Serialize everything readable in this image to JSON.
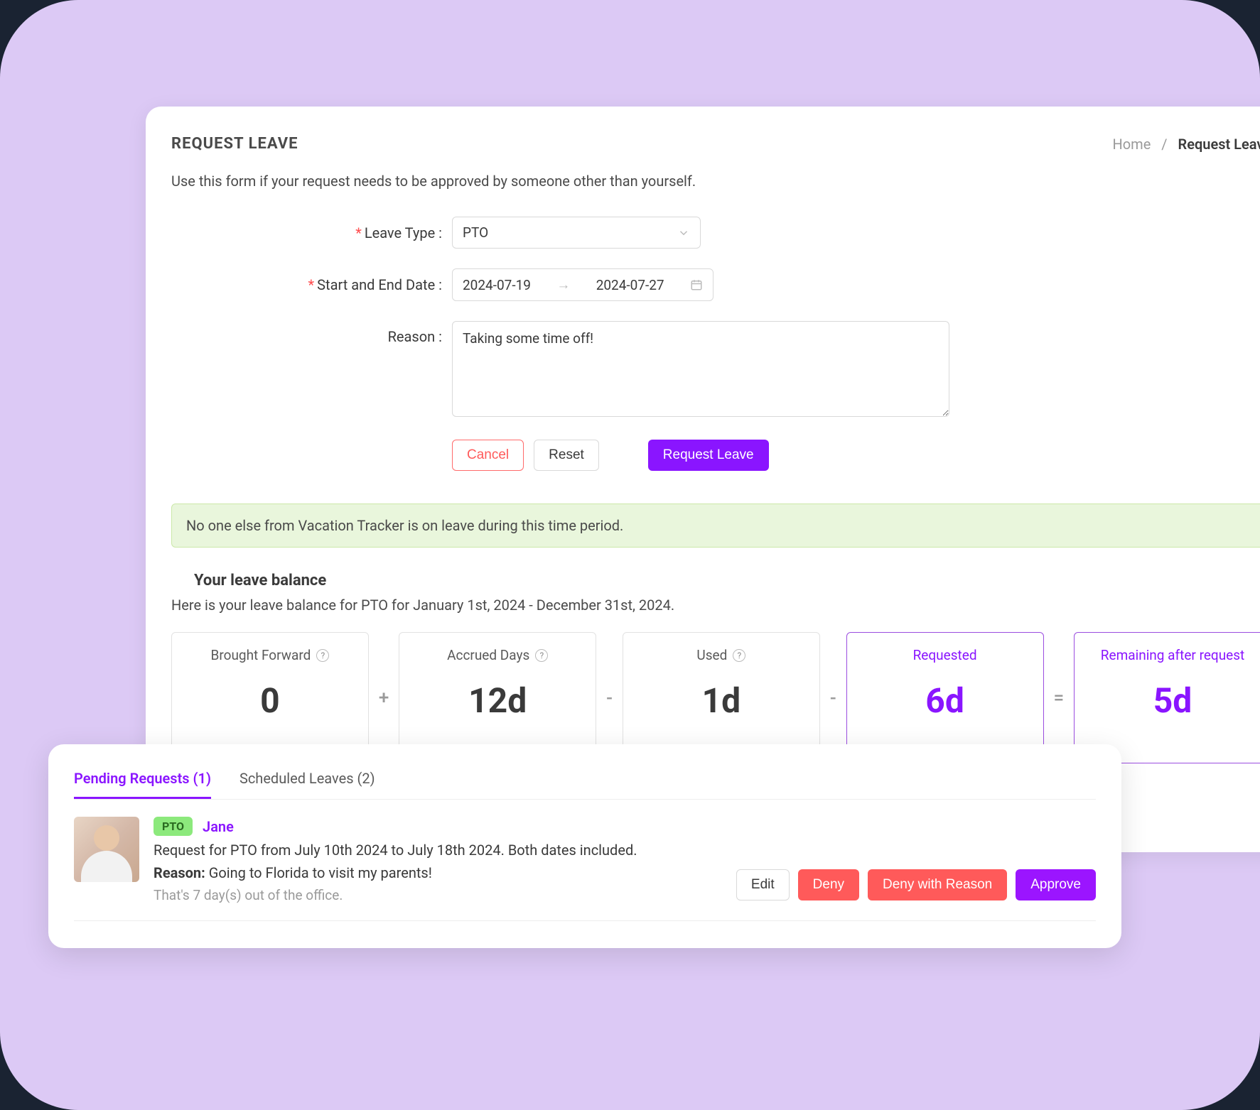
{
  "header": {
    "title": "REQUEST LEAVE",
    "breadcrumb": {
      "home": "Home",
      "current": "Request Leave"
    },
    "subtitle": "Use this form if your request needs to be approved by someone other than yourself."
  },
  "form": {
    "leave_type_label": "Leave Type :",
    "leave_type_value": "PTO",
    "date_label": "Start and End Date :",
    "start_date": "2024-07-19",
    "end_date": "2024-07-27",
    "reason_label": "Reason :",
    "reason_value": "Taking some time off!",
    "buttons": {
      "cancel": "Cancel",
      "reset": "Reset",
      "submit": "Request Leave"
    }
  },
  "info_banner": "No one else from Vacation Tracker is on leave during this time period.",
  "balance": {
    "title": "Your leave balance",
    "subtitle": "Here is your leave balance for PTO for January 1st, 2024 - December 31st, 2024.",
    "cards": {
      "brought_forward": {
        "label": "Brought Forward",
        "value": "0"
      },
      "accrued": {
        "label": "Accrued Days",
        "value": "12d"
      },
      "used": {
        "label": "Used",
        "value": "1d"
      },
      "requested": {
        "label": "Requested",
        "value": "6d"
      },
      "remaining": {
        "label": "Remaining after request",
        "value": "5d"
      }
    },
    "ops": {
      "plus": "+",
      "minus1": "-",
      "minus2": "-",
      "equals": "="
    }
  },
  "pending": {
    "tabs": {
      "pending": "Pending Requests (1)",
      "scheduled": "Scheduled Leaves (2)"
    },
    "item": {
      "badge": "PTO",
      "name": "Jane",
      "desc": "Request for PTO from July 10th 2024 to July 18th 2024. Both dates included.",
      "reason_label": "Reason:",
      "reason_text": " Going to Florida to visit my parents!",
      "days": "That's 7 day(s) out of the office."
    },
    "buttons": {
      "edit": "Edit",
      "deny": "Deny",
      "deny_reason": "Deny with Reason",
      "approve": "Approve"
    }
  }
}
